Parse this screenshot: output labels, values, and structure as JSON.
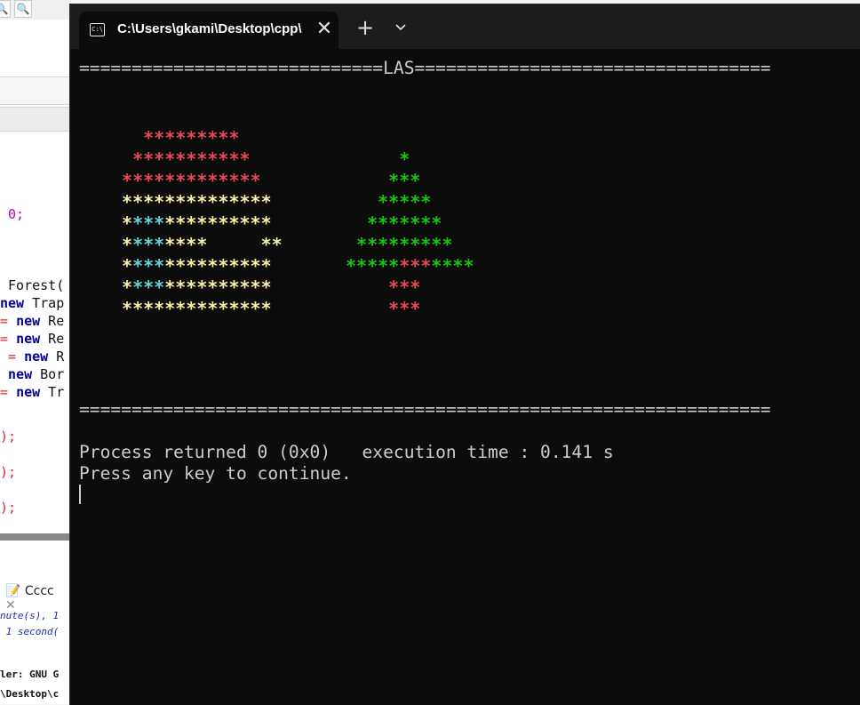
{
  "ide": {
    "code_lines": [
      {
        "parts": [
          {
            "t": " 0;",
            "c": "num"
          }
        ]
      },
      {
        "parts": [
          {
            "t": " Forest(",
            "c": "plain"
          }
        ]
      },
      {
        "parts": [
          {
            "t": "new",
            "c": "kw"
          },
          {
            "t": " Trap",
            "c": "plain"
          }
        ]
      },
      {
        "parts": [
          {
            "t": "= ",
            "c": "red"
          },
          {
            "t": "new",
            "c": "kw"
          },
          {
            "t": " Re",
            "c": "plain"
          }
        ]
      },
      {
        "parts": [
          {
            "t": "= ",
            "c": "red"
          },
          {
            "t": "new",
            "c": "kw"
          },
          {
            "t": " Re",
            "c": "plain"
          }
        ]
      },
      {
        "parts": [
          {
            "t": " = ",
            "c": "red"
          },
          {
            "t": "new",
            "c": "kw"
          },
          {
            "t": " R",
            "c": "plain"
          }
        ]
      },
      {
        "parts": [
          {
            "t": " new",
            "c": "kw"
          },
          {
            "t": " Bor",
            "c": "plain"
          }
        ]
      },
      {
        "parts": [
          {
            "t": "= ",
            "c": "red"
          },
          {
            "t": "new",
            "c": "kw"
          },
          {
            "t": " Tr",
            "c": "plain"
          }
        ]
      },
      {
        "parts": [
          {
            "t": ");",
            "c": "red"
          }
        ]
      },
      {
        "parts": [
          {
            "t": ");",
            "c": "red"
          }
        ]
      },
      {
        "parts": [
          {
            "t": ");",
            "c": "red"
          }
        ]
      }
    ],
    "messages_tab": "Cccc",
    "msg_lines": [
      "nute(s), 1",
      " 1 second(",
      "ler: GNU G",
      "\\Desktop\\c"
    ]
  },
  "terminal": {
    "tab_title": "C:\\Users\\gkami\\Desktop\\cpp\\",
    "tab_icon_text": "C:\\",
    "close_glyph": "✕",
    "new_tab_glyph": "+",
    "header_line": "=============================LAS==================================",
    "footer_line": "==================================================================",
    "process_line": "Process returned 0 (0x0)   execution time : 0.141 s",
    "continue_line": "Press any key to continue.",
    "colors": {
      "red": "#e74856",
      "yellow": "#f9f1a5",
      "cyan": "#61d6d6",
      "green": "#16c60c",
      "text": "#cccccc",
      "background": "#0c0c0c"
    },
    "house_rows": [
      [
        {
          "t": "   *********",
          "c": "red"
        }
      ],
      [
        {
          "t": "  ***********",
          "c": "red"
        }
      ],
      [
        {
          "t": " *************",
          "c": "red"
        }
      ],
      [
        {
          "t": " **************",
          "c": "yel"
        }
      ],
      [
        {
          "t": " *",
          "c": "yel"
        },
        {
          "t": "***",
          "c": "cya"
        },
        {
          "t": "**********",
          "c": "yel"
        }
      ],
      [
        {
          "t": " *",
          "c": "yel"
        },
        {
          "t": "***",
          "c": "cya"
        },
        {
          "t": "****",
          "c": "yel"
        },
        {
          "t": "     ",
          "c": "yel"
        },
        {
          "t": "**",
          "c": "yel"
        }
      ],
      [
        {
          "t": " *",
          "c": "yel"
        },
        {
          "t": "***",
          "c": "cya"
        },
        {
          "t": "**********",
          "c": "yel"
        }
      ],
      [
        {
          "t": " *",
          "c": "yel"
        },
        {
          "t": "***",
          "c": "cya"
        },
        {
          "t": "**********",
          "c": "yel"
        }
      ],
      [
        {
          "t": " **************",
          "c": "yel"
        }
      ]
    ],
    "tree_rows": [
      [
        {
          "t": "",
          "c": "grn"
        }
      ],
      [
        {
          "t": "     *",
          "c": "grn"
        }
      ],
      [
        {
          "t": "    ***",
          "c": "grn"
        }
      ],
      [
        {
          "t": "   *****",
          "c": "grn"
        }
      ],
      [
        {
          "t": "  *******",
          "c": "grn"
        }
      ],
      [
        {
          "t": " *********",
          "c": "grn"
        }
      ],
      [
        {
          "t": "*****",
          "c": "grn"
        },
        {
          "t": "***",
          "c": "red"
        },
        {
          "t": "****",
          "c": "grn"
        }
      ],
      [
        {
          "t": "    ",
          "c": "grn"
        },
        {
          "t": "***",
          "c": "red"
        }
      ],
      [
        {
          "t": "    ",
          "c": "grn"
        },
        {
          "t": "***",
          "c": "red"
        }
      ]
    ]
  }
}
